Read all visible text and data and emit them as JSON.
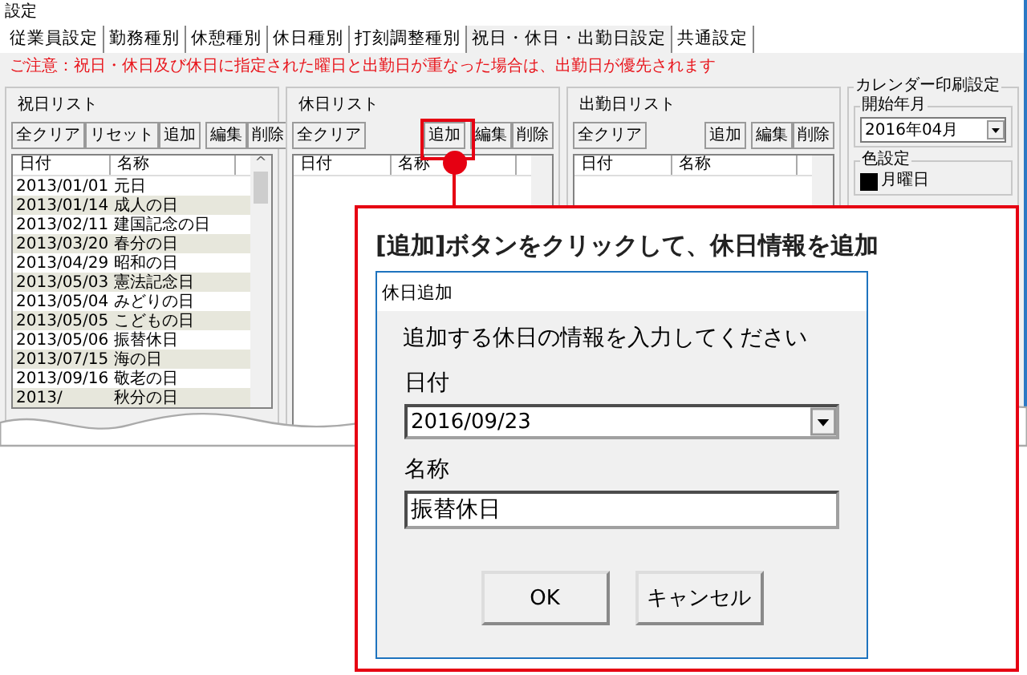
{
  "window": {
    "title": "設定"
  },
  "tabs": [
    {
      "label": "従業員設定",
      "selected": false
    },
    {
      "label": "勤務種別",
      "selected": false
    },
    {
      "label": "休憩種別",
      "selected": false
    },
    {
      "label": "休日種別",
      "selected": false
    },
    {
      "label": "打刻調整種別",
      "selected": false
    },
    {
      "label": "祝日・休日・出勤日設定",
      "selected": true
    },
    {
      "label": "共通設定",
      "selected": false
    }
  ],
  "notice": "ご注意：祝日・休日及び休日に指定された曜日と出勤日が重なった場合は、出勤日が優先されます",
  "lists": [
    {
      "title": "祝日リスト",
      "left_buttons": [
        "全クリア",
        "リセット"
      ],
      "right_buttons": [
        "追加",
        "編集",
        "削除"
      ],
      "columns": [
        "日付",
        "名称"
      ],
      "scroll_arrow": "^",
      "rows": [
        {
          "date": "2013/01/01",
          "name": "元日"
        },
        {
          "date": "2013/01/14",
          "name": "成人の日"
        },
        {
          "date": "2013/02/11",
          "name": "建国記念の日"
        },
        {
          "date": "2013/03/20",
          "name": "春分の日"
        },
        {
          "date": "2013/04/29",
          "name": "昭和の日"
        },
        {
          "date": "2013/05/03",
          "name": "憲法記念日"
        },
        {
          "date": "2013/05/04",
          "name": "みどりの日"
        },
        {
          "date": "2013/05/05",
          "name": "こどもの日"
        },
        {
          "date": "2013/05/06",
          "name": "振替休日"
        },
        {
          "date": "2013/07/15",
          "name": "海の日"
        },
        {
          "date": "2013/09/16",
          "name": "敬老の日"
        },
        {
          "date": "2013/",
          "name": "秋分の日"
        }
      ]
    },
    {
      "title": "休日リスト",
      "left_buttons": [
        "全クリア"
      ],
      "right_buttons": [
        "追加",
        "編集",
        "削除"
      ],
      "columns": [
        "日付",
        "名称"
      ]
    },
    {
      "title": "出勤日リスト",
      "left_buttons": [
        "全クリア"
      ],
      "right_buttons": [
        "追加",
        "編集",
        "削除"
      ],
      "columns": [
        "日付",
        "名称"
      ]
    }
  ],
  "calendar_print": {
    "title": "カレンダー印刷設定",
    "start_month": {
      "label": "開始年月",
      "value": "2016年04月"
    },
    "colors": {
      "label": "色設定",
      "items": [
        {
          "label": "月曜日",
          "color": "#000000"
        }
      ]
    }
  },
  "callout": {
    "caption": "[追加]ボタンをクリックして、休日情報を追加",
    "dialog": {
      "title": "休日追加",
      "prompt": "追加する休日の情報を入力してください",
      "fields": [
        {
          "kind": "select",
          "label": "日付",
          "value": "2016/09/23"
        },
        {
          "kind": "text",
          "label": "名称",
          "value": "振替休日"
        }
      ],
      "buttons": [
        "OK",
        "キャンセル"
      ]
    }
  }
}
